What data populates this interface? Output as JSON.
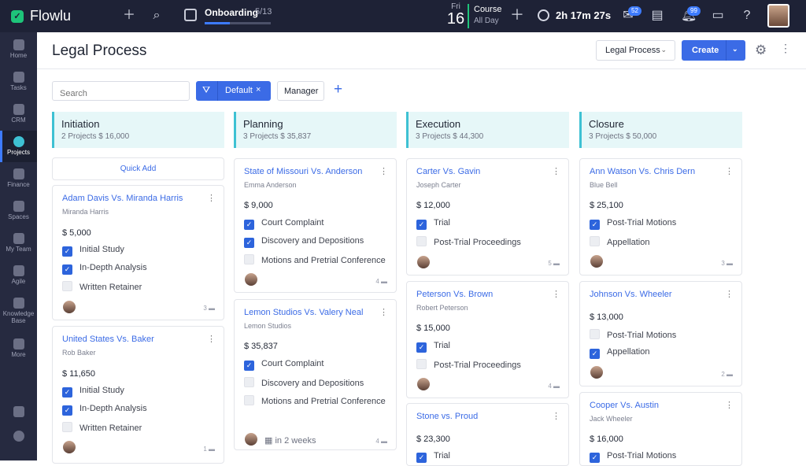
{
  "app": {
    "name": "Flowlu"
  },
  "topbar": {
    "onboarding_label": "Onboarding",
    "onboarding_count": "5/13",
    "onboarding_progress": 0.38,
    "day_name": "Fri",
    "day_number": "16",
    "course_title": "Course",
    "course_sub": "All Day",
    "timer": "2h 17m 27s",
    "mail_badge": "52",
    "bell_badge": "99"
  },
  "sidebar": {
    "items": [
      {
        "label": "Home"
      },
      {
        "label": "Tasks"
      },
      {
        "label": "CRM"
      },
      {
        "label": "Projects"
      },
      {
        "label": "Finance"
      },
      {
        "label": "Spaces"
      },
      {
        "label": "My Team"
      },
      {
        "label": "Agile"
      },
      {
        "label": "Knowledge Base"
      },
      {
        "label": "More"
      }
    ]
  },
  "header": {
    "title": "Legal Process",
    "selector": "Legal Process",
    "create": "Create"
  },
  "toolbar": {
    "search_placeholder": "Search",
    "filter_label": "Default",
    "manager_label": "Manager"
  },
  "columns": [
    {
      "name": "Initiation",
      "summary": "2 Projects   $ 16,000",
      "quick_add": "Quick Add"
    },
    {
      "name": "Planning",
      "summary": "3 Projects   $ 35,837"
    },
    {
      "name": "Execution",
      "summary": "3 Projects   $ 44,300"
    },
    {
      "name": "Closure",
      "summary": "3 Projects   $ 50,000"
    }
  ],
  "cards": {
    "c1": {
      "title": "Adam Davis Vs. Miranda Harris",
      "sub": "Miranda Harris",
      "amount": "$ 5,000",
      "tasks": [
        "Initial Study",
        "In-Depth Analysis",
        "Written Retainer"
      ],
      "done": [
        true,
        true,
        false
      ],
      "comments": "3"
    },
    "c2": {
      "title": "United States Vs. Baker",
      "sub": "Rob Baker",
      "amount": "$ 11,650",
      "tasks": [
        "Initial Study",
        "In-Depth Analysis",
        "Written Retainer"
      ],
      "done": [
        true,
        true,
        false
      ],
      "comments": "1"
    },
    "c3": {
      "title": "State of Missouri Vs. Anderson",
      "sub": "Emma Anderson",
      "amount": "$ 9,000",
      "tasks": [
        "Court Complaint",
        "Discovery and Depositions",
        "Motions and Pretrial Conference"
      ],
      "done": [
        true,
        true,
        false
      ],
      "comments": "4"
    },
    "c4": {
      "title": "Lemon Studios Vs. Valery Neal",
      "sub": "Lemon Studios",
      "amount": "$ 35,837",
      "tasks": [
        "Court Complaint",
        "Discovery and Depositions",
        "Motions and Pretrial Conference"
      ],
      "done": [
        true,
        false,
        false
      ],
      "due": "in 2 weeks",
      "comments": "4"
    },
    "c5": {
      "title": "Carter Vs. Gavin",
      "sub": "Joseph Carter",
      "amount": "$ 12,000",
      "tasks": [
        "Trial",
        "Post-Trial Proceedings"
      ],
      "done": [
        true,
        false
      ],
      "comments": "5"
    },
    "c6": {
      "title": "Peterson Vs. Brown",
      "sub": "Robert Peterson",
      "amount": "$ 15,000",
      "tasks": [
        "Trial",
        "Post-Trial Proceedings"
      ],
      "done": [
        true,
        false
      ],
      "comments": "4"
    },
    "c7": {
      "title": "Stone vs. Proud",
      "amount": "$ 23,300",
      "tasks": [
        "Trial"
      ],
      "done": [
        true
      ]
    },
    "c8": {
      "title": "Ann Watson Vs. Chris Dern",
      "sub": "Blue Bell",
      "amount": "$ 25,100",
      "tasks": [
        "Post-Trial Motions",
        "Appellation"
      ],
      "done": [
        true,
        false
      ],
      "comments": "3"
    },
    "c9": {
      "title": "Johnson Vs. Wheeler",
      "amount": "$ 13,000",
      "tasks": [
        "Post-Trial Motions",
        "Appellation"
      ],
      "done": [
        false,
        true
      ],
      "comments": "2"
    },
    "c10": {
      "title": "Cooper Vs. Austin",
      "sub": "Jack Wheeler",
      "amount": "$ 16,000",
      "tasks": [
        "Post-Trial Motions"
      ],
      "done": [
        true
      ]
    }
  }
}
